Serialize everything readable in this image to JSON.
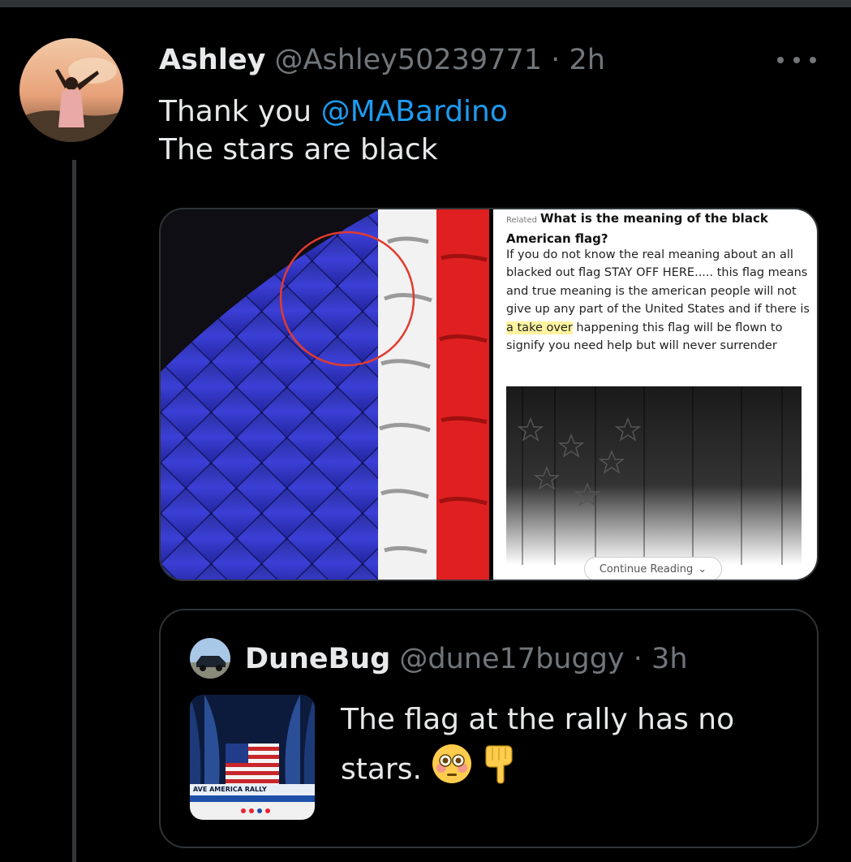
{
  "tweet": {
    "author_name": "Ashley",
    "handle": "@Ashley50239771",
    "separator": "·",
    "time": "2h",
    "text_prefix": "Thank you ",
    "mention": "@MABardino",
    "text_line2": "The stars are black"
  },
  "media": {
    "related_tag": "Related",
    "related_title_line1": "What is the meaning of the black",
    "related_title_line2": "American flag?",
    "body_part1": "If you do not know the real meaning about an all blacked out flag STAY OFF HERE..... this flag means and true meaning is the american people will not give up any part of the United States and if there is ",
    "body_highlight": "a take over",
    "body_part2": " happening this flag will be flown to signify you need help but will never surrender",
    "continue_label": "Continue Reading",
    "banner_text": "AVE AMERICA RALLY"
  },
  "quote": {
    "author_name": "DuneBug",
    "handle": "@dune17buggy",
    "separator": "·",
    "time": "3h",
    "text_line1": "The flag at the rally has no",
    "text_line2": "stars."
  },
  "icons": {
    "more": "more-options-icon",
    "flushed": "flushed-face-emoji",
    "point_down": "pointing-down-emoji"
  },
  "colors": {
    "background": "#000000",
    "text": "#e7e9ea",
    "muted": "#71767b",
    "accent": "#1d9bf0",
    "border": "#2f3336"
  }
}
